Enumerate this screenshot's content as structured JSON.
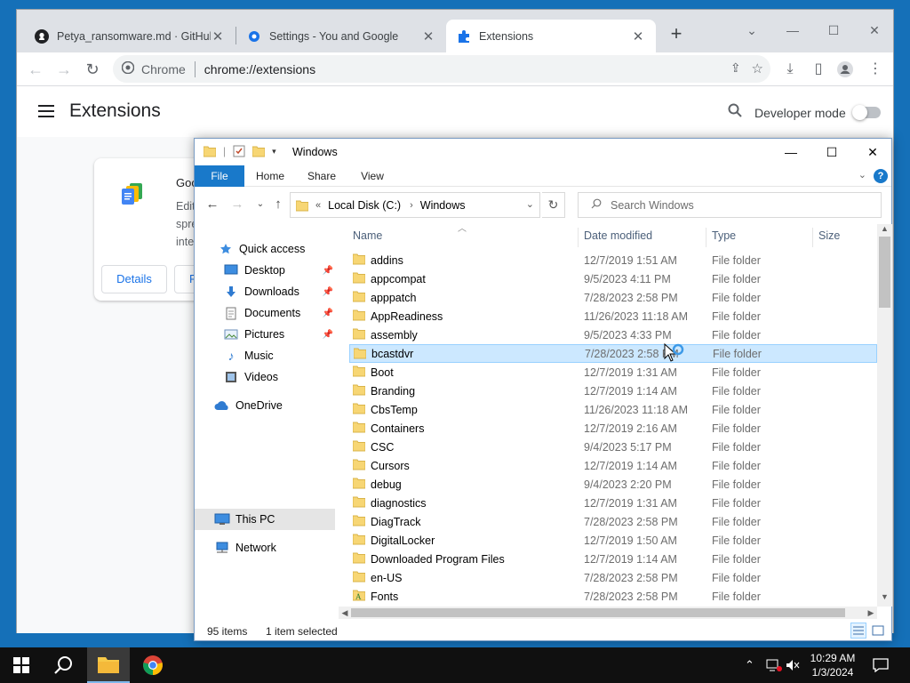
{
  "chrome": {
    "tabs": [
      {
        "label": "Petya_ransomware.md · GitHub",
        "icon": "github-icon",
        "active": false
      },
      {
        "label": "Settings - You and Google",
        "icon": "settings-gear-icon",
        "active": false
      },
      {
        "label": "Extensions",
        "icon": "puzzle-icon",
        "active": true
      }
    ],
    "omnibox": {
      "site_label": "Chrome",
      "url": "chrome://extensions"
    },
    "page": {
      "title": "Extensions",
      "developer_mode_label": "Developer mode",
      "developer_mode_on": false,
      "card": {
        "name": "Goo",
        "description": "Edit spre inte",
        "details_label": "Details",
        "remove_label": "R"
      }
    }
  },
  "explorer": {
    "title": "Windows",
    "ribbon_tabs": [
      "File",
      "Home",
      "Share",
      "View"
    ],
    "address": {
      "overflow": "«",
      "segments": [
        "Local Disk (C:)",
        "Windows"
      ]
    },
    "search_placeholder": "Search Windows",
    "nav": [
      {
        "label": "Quick access",
        "icon": "star-icon",
        "pinned": false,
        "indent": 0
      },
      {
        "label": "Desktop",
        "icon": "desktop-icon",
        "pinned": true,
        "indent": 1
      },
      {
        "label": "Downloads",
        "icon": "download-arrow-icon",
        "pinned": true,
        "indent": 1
      },
      {
        "label": "Documents",
        "icon": "documents-icon",
        "pinned": true,
        "indent": 1
      },
      {
        "label": "Pictures",
        "icon": "pictures-icon",
        "pinned": true,
        "indent": 1
      },
      {
        "label": "Music",
        "icon": "music-note-icon",
        "pinned": false,
        "indent": 1
      },
      {
        "label": "Videos",
        "icon": "videos-icon",
        "pinned": false,
        "indent": 1
      },
      {
        "label": "OneDrive",
        "icon": "cloud-icon",
        "pinned": false,
        "indent": 0
      },
      {
        "label": "This PC",
        "icon": "computer-icon",
        "pinned": false,
        "indent": 0,
        "selected": true
      },
      {
        "label": "Network",
        "icon": "network-icon",
        "pinned": false,
        "indent": 0
      }
    ],
    "columns": [
      "Name",
      "Date modified",
      "Type",
      "Size"
    ],
    "files": [
      {
        "name": "addins",
        "date": "12/7/2019 1:51 AM",
        "type": "File folder"
      },
      {
        "name": "appcompat",
        "date": "9/5/2023 4:11 PM",
        "type": "File folder"
      },
      {
        "name": "apppatch",
        "date": "7/28/2023 2:58 PM",
        "type": "File folder"
      },
      {
        "name": "AppReadiness",
        "date": "11/26/2023 11:18 AM",
        "type": "File folder"
      },
      {
        "name": "assembly",
        "date": "9/5/2023 4:33 PM",
        "type": "File folder"
      },
      {
        "name": "bcastdvr",
        "date": "7/28/2023 2:58 PM",
        "type": "File folder",
        "selected": true
      },
      {
        "name": "Boot",
        "date": "12/7/2019 1:31 AM",
        "type": "File folder"
      },
      {
        "name": "Branding",
        "date": "12/7/2019 1:14 AM",
        "type": "File folder"
      },
      {
        "name": "CbsTemp",
        "date": "11/26/2023 11:18 AM",
        "type": "File folder"
      },
      {
        "name": "Containers",
        "date": "12/7/2019 2:16 AM",
        "type": "File folder"
      },
      {
        "name": "CSC",
        "date": "9/4/2023 5:17 PM",
        "type": "File folder"
      },
      {
        "name": "Cursors",
        "date": "12/7/2019 1:14 AM",
        "type": "File folder"
      },
      {
        "name": "debug",
        "date": "9/4/2023 2:20 PM",
        "type": "File folder"
      },
      {
        "name": "diagnostics",
        "date": "12/7/2019 1:31 AM",
        "type": "File folder"
      },
      {
        "name": "DiagTrack",
        "date": "7/28/2023 2:58 PM",
        "type": "File folder"
      },
      {
        "name": "DigitalLocker",
        "date": "12/7/2019 1:50 AM",
        "type": "File folder"
      },
      {
        "name": "Downloaded Program Files",
        "date": "12/7/2019 1:14 AM",
        "type": "File folder"
      },
      {
        "name": "en-US",
        "date": "7/28/2023 2:58 PM",
        "type": "File folder"
      },
      {
        "name": "Fonts",
        "date": "7/28/2023 2:58 PM",
        "type": "File folder",
        "special_icon": "fonts-icon"
      }
    ],
    "status": {
      "items": "95 items",
      "selected": "1 item selected"
    }
  },
  "taskbar": {
    "clock_time": "10:29 AM",
    "clock_date": "1/3/2024",
    "pinned": [
      "start-icon",
      "search-icon",
      "file-explorer-icon",
      "chrome-icon"
    ]
  },
  "colors": {
    "desktop": "#1570b8",
    "accent": "#1979ca",
    "selection": "#cce8ff",
    "folder": "#f7d674"
  }
}
